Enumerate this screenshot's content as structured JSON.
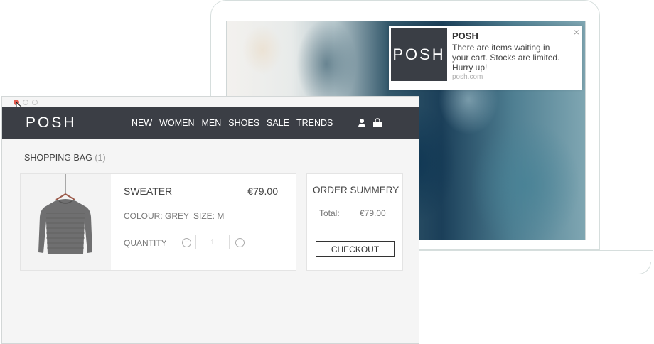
{
  "notification": {
    "logo_text": "POSH",
    "title": "POSH",
    "message": "There are items waiting in your cart. Stocks are limited. Hurry up!",
    "domain": "posh.com",
    "close_symbol": "×"
  },
  "header": {
    "brand": "POSH",
    "menu": [
      "NEW",
      "WOMEN",
      "MEN",
      "SHOES",
      "SALE",
      "TRENDS"
    ],
    "icons": [
      "user-icon",
      "shopping-bag-icon"
    ],
    "color": "#3b3e45"
  },
  "bag": {
    "title": "SHOPPING BAG",
    "count": "(1)"
  },
  "item": {
    "name": "SWEATER",
    "price": "€79.00",
    "colour": "COLOUR: GREY",
    "size": "SIZE: M",
    "quantity_label": "QUANTITY",
    "quantity": "1",
    "minus": "−",
    "plus": "+"
  },
  "summary": {
    "title": "ORDER SUMMERY",
    "total_label": "Total:",
    "total_value": "€79.00",
    "checkout_label": "CHECKOUT"
  },
  "colors": {
    "nav": "#3b3e45",
    "close_dot": "#e05a4e"
  }
}
